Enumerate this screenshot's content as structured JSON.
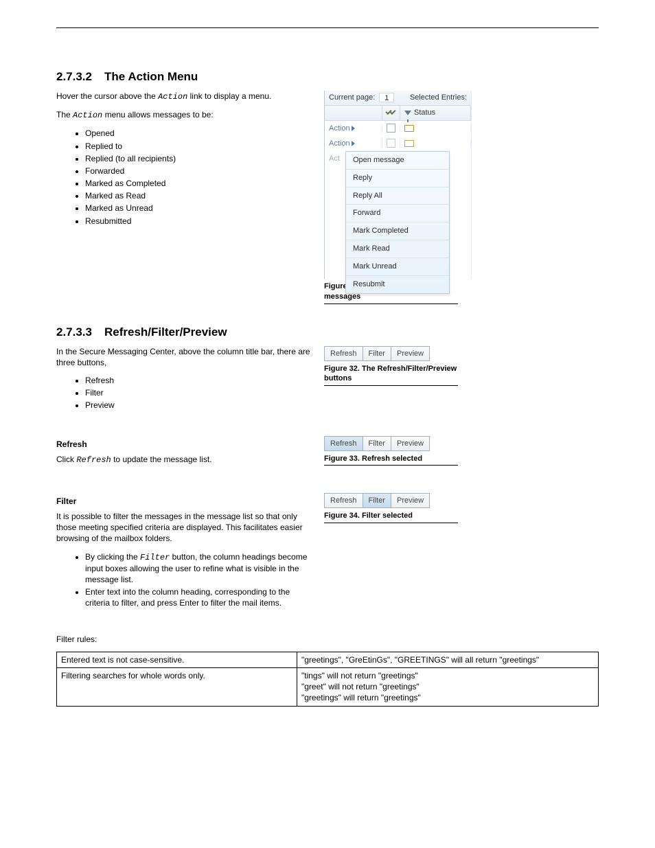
{
  "section_action_menu": {
    "num": "2.7.3.2",
    "title": "The Action Menu",
    "para1_pre": "Hover the cursor above the ",
    "para1_link": "Action",
    "para1_post": " link to display a menu.",
    "para2_pre": "The ",
    "para2_link": "Action",
    "para2_post": " menu allows messages to be:",
    "items": [
      "Opened",
      "Replied to",
      "Replied (to all recipients)",
      "Forwarded",
      "Marked as Completed",
      "Marked as Read",
      "Marked as Unread",
      "Resubmitted"
    ]
  },
  "figure31": {
    "label": "Figure 31. Performing actions on messages",
    "current_page_label": "Current page:",
    "current_page_value": "1",
    "selected_label": "Selected Entries:",
    "status_label": "Status",
    "row_link": "Action",
    "menu": [
      "Open message",
      "Reply",
      "Reply All",
      "Forward",
      "Mark Completed",
      "Mark Read",
      "Mark Unread",
      "Resubmit"
    ]
  },
  "section_rfp": {
    "num": "2.7.3.3",
    "title": "Refresh/Filter/Preview",
    "intro_pre": "In the Secure Messaging Center, above the column title bar, there are three buttons,",
    "items": [
      "Refresh",
      "Filter",
      "Preview"
    ]
  },
  "figure32": {
    "label": "Figure 32. The Refresh/Filter/Preview buttons",
    "buttons": [
      "Refresh",
      "Filter",
      "Preview"
    ]
  },
  "refresh": {
    "head": "Refresh",
    "line_pre": "Click ",
    "line_link": "Refresh",
    "line_post": " to update the message list."
  },
  "figure33": {
    "label": "Figure 33. Refresh selected",
    "buttons": [
      "Refresh",
      "Filter",
      "Preview"
    ]
  },
  "filter": {
    "head": "Filter",
    "intro": "It is possible to filter the messages in the message list so that only those meeting specified criteria are displayed. This facilitates easier browsing of the mailbox folders.",
    "b1_pre": "By clicking the ",
    "b1_link": "Filter",
    "b1_post": " button, the column headings become input boxes allowing the user to refine what is visible in the message list.",
    "b2": "Enter text into the column heading, corresponding to the criteria to filter, and press Enter to filter the mail items."
  },
  "figure34": {
    "label": "Figure 34. Filter selected",
    "buttons": [
      "Refresh",
      "Filter",
      "Preview"
    ]
  },
  "filter_rules_head": "Filter rules:",
  "filter_table": {
    "r1": {
      "left": "Entered text is not case-sensitive.",
      "right": "\"greetings\", \"GreEtinGs\", \"GREETINGS\" will all return \"greetings\""
    },
    "r2": {
      "left": "Filtering searches for whole words only.",
      "right": "\"tings\" will not return \"greetings\"\n\"greet\" will not return \"greetings\"\n\"greetings\" will return \"greetings\""
    }
  }
}
